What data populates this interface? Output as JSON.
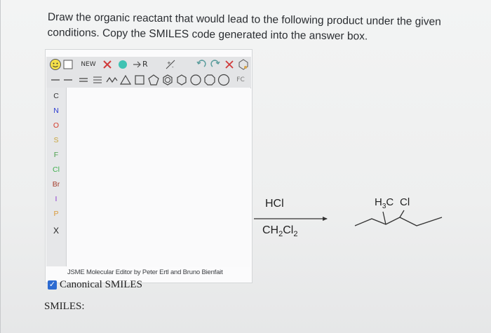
{
  "question": {
    "text_line1": "Draw the organic reactant that would lead to the following product under the given",
    "text_line2": "conditions. Copy the SMILES code generated into the answer box."
  },
  "jsme": {
    "new_label": "NEW",
    "r_label": "R",
    "fc_label": "FC",
    "side_elements": [
      "C",
      "N",
      "O",
      "S",
      "F",
      "Cl",
      "Br",
      "I",
      "P",
      "X"
    ],
    "side_colors": [
      "#333333",
      "#2b3bd1",
      "#d43b2a",
      "#c9a43c",
      "#4aa04a",
      "#3fb04f",
      "#a33b2a",
      "#8b3ad1",
      "#d99a3a",
      "#222222"
    ],
    "credit": "JSME Molecular Editor by Peter Ertl and Bruno Bienfait"
  },
  "options": {
    "canonical_label": "Canonical SMILES",
    "canonical_checked": true,
    "smiles_label": "SMILES:"
  },
  "reaction": {
    "reagent_top": "HCl",
    "reagent_bottom_main": "CH",
    "reagent_bottom_sub1": "2",
    "reagent_bottom_mid": "Cl",
    "reagent_bottom_sub2": "2",
    "product_label_left_main": "H",
    "product_label_left_sub": "3",
    "product_label_left_end": "C",
    "product_label_right": "Cl"
  }
}
